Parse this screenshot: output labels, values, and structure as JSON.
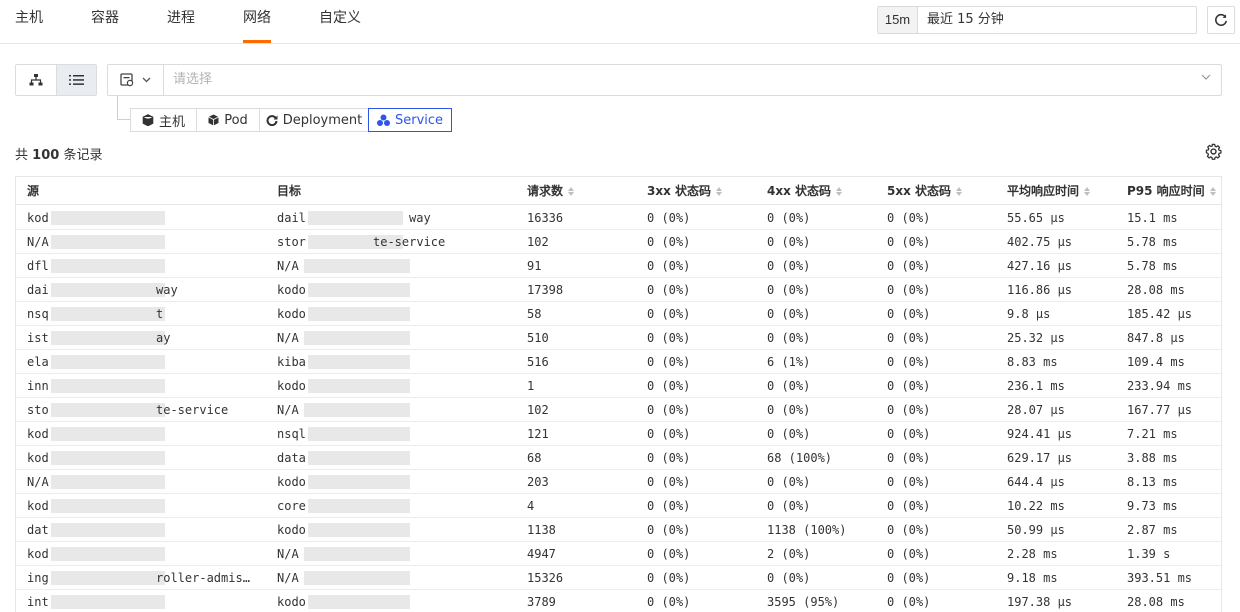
{
  "nav": {
    "tabs": [
      {
        "label": "主机"
      },
      {
        "label": "容器"
      },
      {
        "label": "进程"
      },
      {
        "label": "网络",
        "active": true
      },
      {
        "label": "自定义"
      }
    ],
    "time_short": "15m",
    "time_text": "最近 15 分钟"
  },
  "filter": {
    "placeholder": "请选择",
    "segments": [
      {
        "label": "主机",
        "icon": "cubes-icon"
      },
      {
        "label": "Pod",
        "icon": "cube-icon"
      },
      {
        "label": "Deployment",
        "icon": "deployment-icon"
      },
      {
        "label": "Service",
        "icon": "service-icon",
        "active": true
      }
    ]
  },
  "summary": {
    "prefix": "共",
    "count": "100",
    "suffix": "条记录"
  },
  "table": {
    "columns": [
      "源",
      "目标",
      "请求数",
      "3xx 状态码",
      "4xx 状态码",
      "5xx 状态码",
      "平均响应时间",
      "P95 响应时间"
    ],
    "rows": [
      {
        "source": "kod",
        "target": "dail",
        "target_tail": "way",
        "requests": "16336",
        "s3xx": "0 (0%)",
        "s4xx": "0 (0%)",
        "s5xx": "0 (0%)",
        "avg": "55.65 μs",
        "p95": "15.1 ms"
      },
      {
        "source": "N/A",
        "target": "stor",
        "target_tail": "te-service",
        "requests": "102",
        "s3xx": "0 (0%)",
        "s4xx": "0 (0%)",
        "s5xx": "0 (0%)",
        "avg": "402.75 μs",
        "p95": "5.78 ms"
      },
      {
        "source": "dfl",
        "target": "N/A",
        "requests": "91",
        "s3xx": "0 (0%)",
        "s4xx": "0 (0%)",
        "s5xx": "0 (0%)",
        "avg": "427.16 μs",
        "p95": "5.78 ms"
      },
      {
        "source": "dai",
        "source_tail": "way",
        "target": "kodo",
        "requests": "17398",
        "s3xx": "0 (0%)",
        "s4xx": "0 (0%)",
        "s5xx": "0 (0%)",
        "avg": "116.86 μs",
        "p95": "28.08 ms"
      },
      {
        "source": "nsq",
        "source_tail": "t",
        "target": "kodo",
        "requests": "58",
        "s3xx": "0 (0%)",
        "s4xx": "0 (0%)",
        "s5xx": "0 (0%)",
        "avg": "9.8 μs",
        "p95": "185.42 μs"
      },
      {
        "source": "ist",
        "source_tail": "ay",
        "target": "N/A",
        "requests": "510",
        "s3xx": "0 (0%)",
        "s4xx": "0 (0%)",
        "s5xx": "0 (0%)",
        "avg": "25.32 μs",
        "p95": "847.8 μs"
      },
      {
        "source": "ela",
        "target": "kiba",
        "requests": "516",
        "s3xx": "0 (0%)",
        "s4xx": "6 (1%)",
        "s5xx": "0 (0%)",
        "avg": "8.83 ms",
        "p95": "109.4 ms"
      },
      {
        "source": "inn",
        "target": "kodo",
        "requests": "1",
        "s3xx": "0 (0%)",
        "s4xx": "0 (0%)",
        "s5xx": "0 (0%)",
        "avg": "236.1 ms",
        "p95": "233.94 ms"
      },
      {
        "source": "sto",
        "source_tail": "te-service",
        "target": "N/A",
        "requests": "102",
        "s3xx": "0 (0%)",
        "s4xx": "0 (0%)",
        "s5xx": "0 (0%)",
        "avg": "28.07 μs",
        "p95": "167.77 μs"
      },
      {
        "source": "kod",
        "target": "nsql",
        "requests": "121",
        "s3xx": "0 (0%)",
        "s4xx": "0 (0%)",
        "s5xx": "0 (0%)",
        "avg": "924.41 μs",
        "p95": "7.21 ms"
      },
      {
        "source": "kod",
        "target": "data",
        "requests": "68",
        "s3xx": "0 (0%)",
        "s4xx": "68 (100%)",
        "s5xx": "0 (0%)",
        "avg": "629.17 μs",
        "p95": "3.88 ms"
      },
      {
        "source": "N/A",
        "target": "kodo",
        "requests": "203",
        "s3xx": "0 (0%)",
        "s4xx": "0 (0%)",
        "s5xx": "0 (0%)",
        "avg": "644.4 μs",
        "p95": "8.13 ms"
      },
      {
        "source": "kod",
        "target": "core",
        "requests": "4",
        "s3xx": "0 (0%)",
        "s4xx": "0 (0%)",
        "s5xx": "0 (0%)",
        "avg": "10.22 ms",
        "p95": "9.73 ms"
      },
      {
        "source": "dat",
        "target": "kodo",
        "requests": "1138",
        "s3xx": "0 (0%)",
        "s4xx": "1138 (100%)",
        "s5xx": "0 (0%)",
        "avg": "50.99 μs",
        "p95": "2.87 ms"
      },
      {
        "source": "kod",
        "target": "N/A",
        "requests": "4947",
        "s3xx": "0 (0%)",
        "s4xx": "2 (0%)",
        "s5xx": "0 (0%)",
        "avg": "2.28 ms",
        "p95": "1.39 s"
      },
      {
        "source": "ing",
        "source_tail": "roller-admis…",
        "target": "N/A",
        "requests": "15326",
        "s3xx": "0 (0%)",
        "s4xx": "0 (0%)",
        "s5xx": "0 (0%)",
        "avg": "9.18 ms",
        "p95": "393.51 ms"
      },
      {
        "source": "int",
        "target": "kodo",
        "requests": "3789",
        "s3xx": "0 (0%)",
        "s4xx": "3595 (95%)",
        "s5xx": "0 (0%)",
        "avg": "197.38 μs",
        "p95": "28.08 ms"
      }
    ]
  },
  "colors": {
    "accent": "#ff6a00",
    "primary": "#2f54eb",
    "border": "#dcdcdc"
  }
}
